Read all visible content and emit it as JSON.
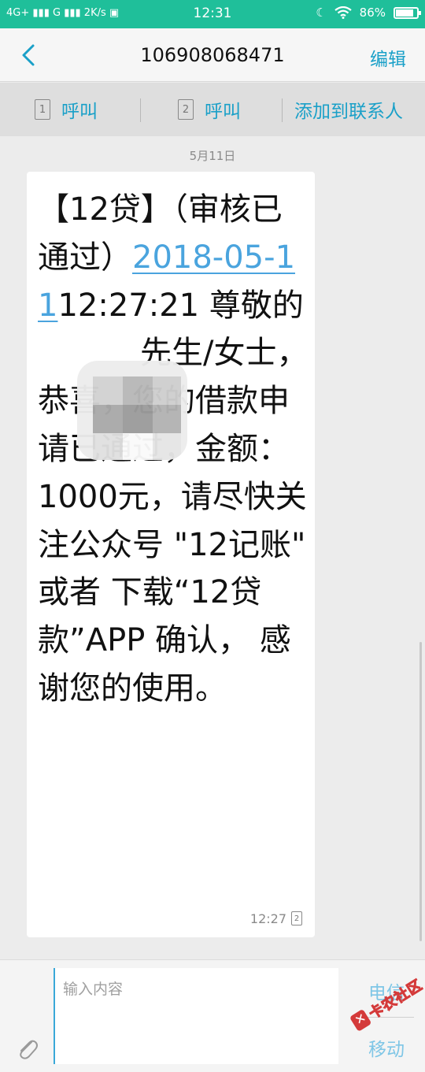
{
  "status_bar": {
    "network": "4G+",
    "network2": "G",
    "speed": "2K/s",
    "time": "12:31",
    "battery": "86%",
    "battery_level": 0.86
  },
  "header": {
    "title": "106908068471",
    "edit_label": "编辑",
    "back_icon": "chevron-left-icon"
  },
  "actions": {
    "call1_label": "呼叫",
    "sim1": "1",
    "call2_label": "呼叫",
    "sim2": "2",
    "add_contact_label": "添加到联系人"
  },
  "conversation": {
    "date": "5月11日",
    "message": {
      "part1": "【12贷】（审核已通过）",
      "date_link": "2018-05-11",
      "part2": "12:27:21 尊敬的",
      "part3": "先生/女士，恭喜，您的借款申请已通过，金额：1000元，请尽快关注公众号 \"12记账\" 或者 下载“12贷款”APP 确认， 感谢您的使用。",
      "time": "12:27",
      "sim": "2"
    }
  },
  "composer": {
    "placeholder": "输入内容",
    "send_telecom": "电信",
    "send_mobile": "移动"
  },
  "watermark": {
    "text": "卡农社区"
  },
  "colors": {
    "status_bar": "#1fbf9a",
    "accent": "#1aa0c8",
    "link": "#4aa4de"
  }
}
